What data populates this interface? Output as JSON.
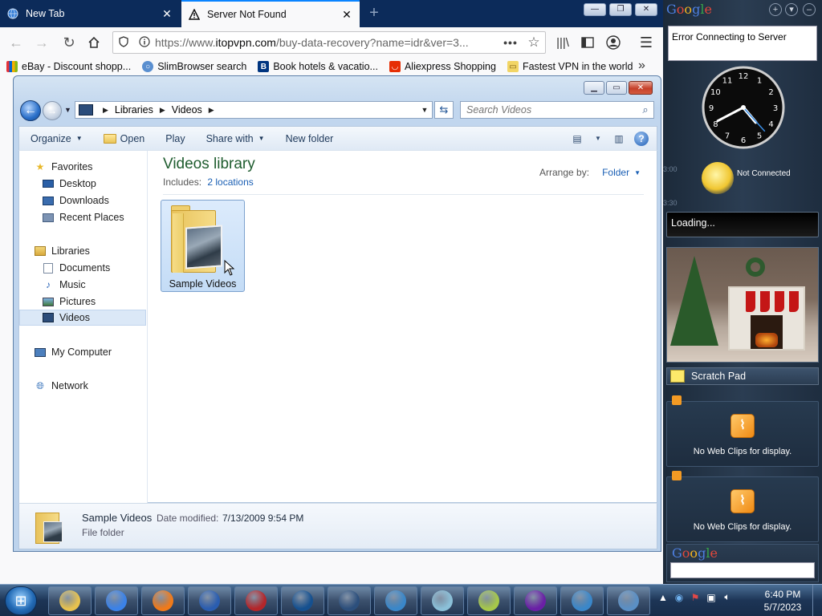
{
  "firefox": {
    "tabs": [
      {
        "title": "New Tab",
        "icon": "globe-icon",
        "active": false
      },
      {
        "title": "Server Not Found",
        "icon": "warning-icon",
        "active": true
      }
    ],
    "newtab_glyph": "+",
    "url": {
      "protocol": "https://www.",
      "domain": "itopvpn.com",
      "path": "/buy-data-recovery?name=idr&ver=3..."
    },
    "bookmarks": [
      {
        "label": "eBay - Discount shopp...",
        "icon": "ebay-icon"
      },
      {
        "label": "SlimBrowser search",
        "icon": "slimbrowser-icon"
      },
      {
        "label": "Book hotels & vacatio...",
        "icon": "booking-icon"
      },
      {
        "label": "Aliexpress Shopping",
        "icon": "aliexpress-icon"
      },
      {
        "label": "Fastest VPN in the world",
        "icon": "vpn-icon"
      }
    ]
  },
  "explorer": {
    "breadcrumb": [
      "Libraries",
      "Videos"
    ],
    "search_placeholder": "Search Videos",
    "toolbar": {
      "organize": "Organize",
      "open": "Open",
      "play": "Play",
      "share_with": "Share with",
      "new_folder": "New folder"
    },
    "nav": {
      "favorites": "Favorites",
      "favorites_items": [
        "Desktop",
        "Downloads",
        "Recent Places"
      ],
      "libraries": "Libraries",
      "libraries_items": [
        "Documents",
        "Music",
        "Pictures",
        "Videos"
      ],
      "computer": "My Computer",
      "network": "Network",
      "selected": "Videos"
    },
    "library": {
      "title": "Videos library",
      "includes_label": "Includes:",
      "includes_link": "2 locations",
      "arrange_label": "Arrange by:",
      "arrange_value": "Folder"
    },
    "items": [
      {
        "name": "Sample Videos",
        "icon": "folder-icon"
      }
    ],
    "details": {
      "name": "Sample Videos",
      "modified_label": "Date modified:",
      "modified_value": "7/13/2009 9:54 PM",
      "type": "File folder"
    }
  },
  "sidebar": {
    "logo_text": "Google",
    "error_text": "Error Connecting to Server",
    "clock": {
      "hour": 4,
      "minute": 40,
      "second": 23
    },
    "weather": {
      "status": "Not Connected",
      "time1": "3:00",
      "time2": "3:30"
    },
    "news": "Loading...",
    "scratch_pad": "Scratch Pad",
    "webclips": [
      "No Web Clips for display.",
      "No Web Clips for display."
    ],
    "search_logo": "Google"
  },
  "taskbar": {
    "apps": [
      {
        "name": "file-explorer-app",
        "color": "#e7c24f"
      },
      {
        "name": "chrome-app",
        "color": "#3b82e8"
      },
      {
        "name": "firefox-app",
        "color": "#f07a1a"
      },
      {
        "name": "app-a-app",
        "color": "#2a5db0"
      },
      {
        "name": "redapp-app",
        "color": "#b4262a"
      },
      {
        "name": "ccleaner-app",
        "color": "#15508f"
      },
      {
        "name": "settings-app",
        "color": "#2c4f7c"
      },
      {
        "name": "globe-app",
        "color": "#3a87c9"
      },
      {
        "name": "notes-app",
        "color": "#8bc0d8"
      },
      {
        "name": "sticky-app",
        "color": "#a6c84a"
      },
      {
        "name": "yahoo-app",
        "color": "#6a1fa6"
      },
      {
        "name": "ie-globe-app",
        "color": "#3a87c9"
      },
      {
        "name": "display-app",
        "color": "#5a8fc5"
      }
    ],
    "time": "6:40 PM",
    "date": "5/7/2023"
  }
}
